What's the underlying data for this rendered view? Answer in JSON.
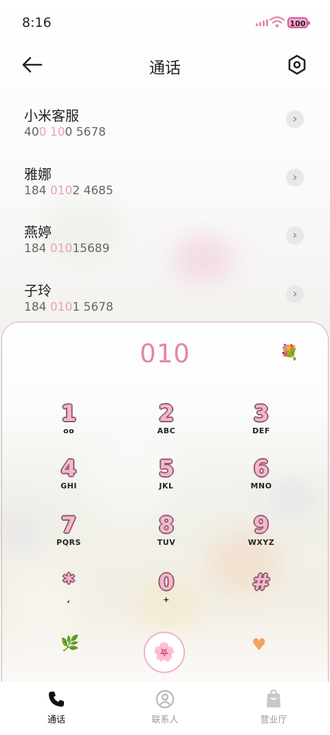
{
  "status_bar": {
    "time": "8:16",
    "battery": "100"
  },
  "header": {
    "title": "通话"
  },
  "contacts": [
    {
      "name": "小米客服",
      "num_a": "40",
      "num_b": "0",
      "num_c": " ",
      "num_d": "10",
      "num_e": "0 5678"
    },
    {
      "name": "雅娜",
      "num_a": "184 ",
      "num_b": "010",
      "num_c": "",
      "num_d": "",
      "num_e": "2 4685"
    },
    {
      "name": "燕婷",
      "num_a": "184 ",
      "num_b": "010",
      "num_c": "",
      "num_d": "",
      "num_e": "15689"
    },
    {
      "name": "子玲",
      "num_a": "184 ",
      "num_b": "010",
      "num_c": "",
      "num_d": "",
      "num_e": "1 5678"
    }
  ],
  "dialer": {
    "display": "010",
    "keys": [
      {
        "digit": "1",
        "letters": "ᴏᴏ"
      },
      {
        "digit": "2",
        "letters": "ABC"
      },
      {
        "digit": "3",
        "letters": "DEF"
      },
      {
        "digit": "4",
        "letters": "GHI"
      },
      {
        "digit": "5",
        "letters": "JKL"
      },
      {
        "digit": "6",
        "letters": "MNO"
      },
      {
        "digit": "7",
        "letters": "PQRS"
      },
      {
        "digit": "8",
        "letters": "TUV"
      },
      {
        "digit": "9",
        "letters": "WXYZ"
      },
      {
        "digit": "*",
        "letters": ","
      },
      {
        "digit": "0",
        "letters": "+"
      },
      {
        "digit": "#",
        "letters": ""
      }
    ]
  },
  "tabs": [
    {
      "label": "通话",
      "active": true
    },
    {
      "label": "联系人",
      "active": false
    },
    {
      "label": "营业厅",
      "active": false
    }
  ],
  "colors": {
    "accent": "#e385ac",
    "keypad_digit": "#f5b7cf"
  }
}
